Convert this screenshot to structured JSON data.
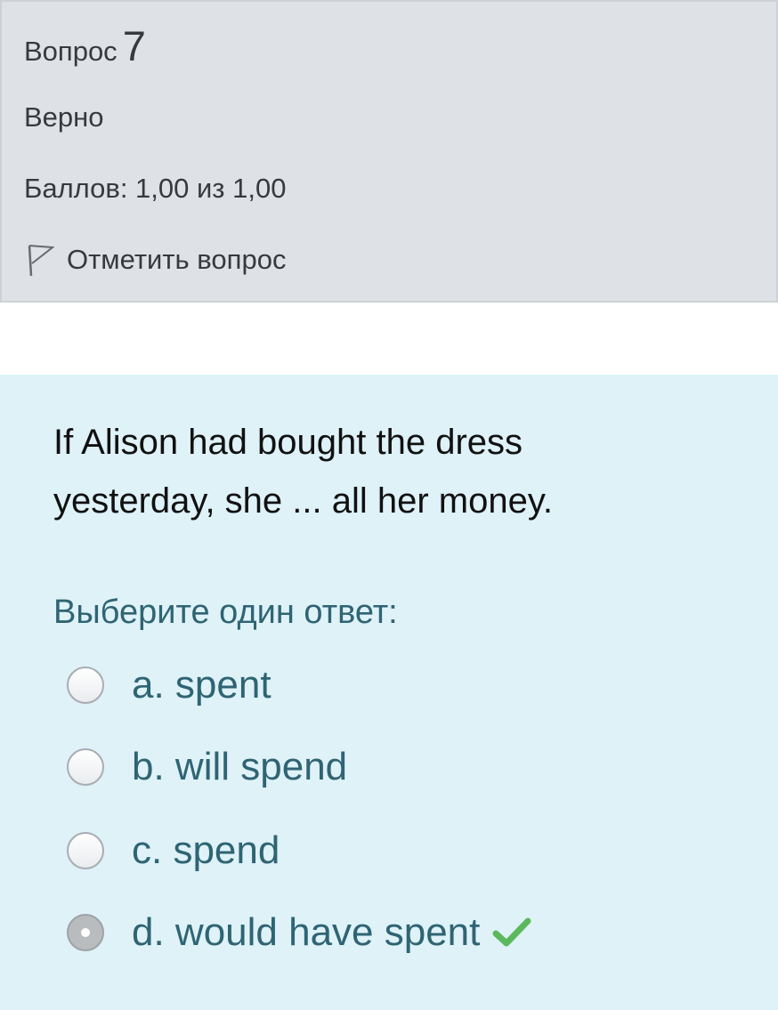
{
  "question_info": {
    "label": "Вопрос",
    "number": "7",
    "state": "Верно",
    "grade": "Баллов: 1,00 из 1,00",
    "flag_label": "Отметить вопрос",
    "flag_icon": "flag-outline-icon"
  },
  "question": {
    "text_line1": "If Alison had bought the dress",
    "text_line2": "yesterday, she ...  all her money.",
    "prompt": "Выберите один ответ:",
    "answers": [
      {
        "label": "a. spent",
        "selected": false
      },
      {
        "label": "b. will spend",
        "selected": false
      },
      {
        "label": "c. spend",
        "selected": false
      },
      {
        "label": "d. would have spent",
        "selected": true,
        "feedback_icon": "checkmark-icon"
      }
    ]
  },
  "colors": {
    "info_background": "#dee2e6",
    "content_background": "#def2f8",
    "answer_text": "#2f6473",
    "correct_check": "#5cb85c"
  }
}
